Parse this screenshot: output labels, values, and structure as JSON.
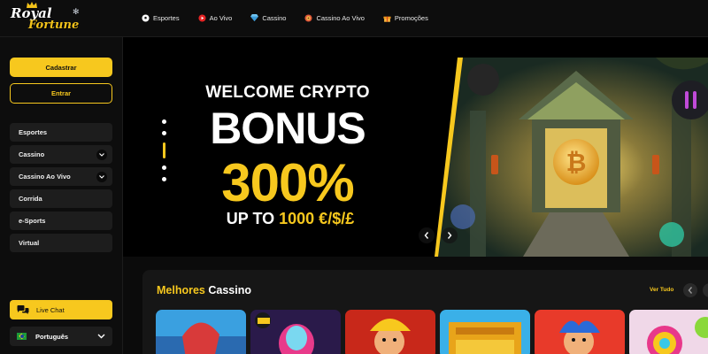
{
  "brand": {
    "line1": "Royal",
    "line2": "Fortune"
  },
  "nav": [
    {
      "label": "Esportes",
      "icon": "soccer-ball-icon"
    },
    {
      "label": "Ao Vivo",
      "icon": "live-play-icon"
    },
    {
      "label": "Cassino",
      "icon": "diamond-icon"
    },
    {
      "label": "Cassino Ao Vivo",
      "icon": "roulette-icon"
    },
    {
      "label": "Promoções",
      "icon": "gift-icon"
    }
  ],
  "sidebar": {
    "signup_label": "Cadastrar",
    "login_label": "Entrar",
    "items": [
      {
        "label": "Esportes",
        "has_dropdown": false
      },
      {
        "label": "Cassino",
        "has_dropdown": true
      },
      {
        "label": "Cassino Ao Vivo",
        "has_dropdown": true
      },
      {
        "label": "Corrida",
        "has_dropdown": false
      },
      {
        "label": "e-Sports",
        "has_dropdown": false
      },
      {
        "label": "Virtual",
        "has_dropdown": false
      }
    ],
    "chat_label": "Live Chat",
    "language_label": "Português"
  },
  "banner": {
    "line1": "WELCOME CRYPTO",
    "line2": "BONUS",
    "line3": "300%",
    "line4_prefix": "UP TO ",
    "line4_highlight": "1000 €/$/£",
    "slide_count": 5,
    "active_slide": 3
  },
  "section": {
    "title_highlight": "Melhores",
    "title_rest": " Cassino",
    "view_all_label": "Ver Tudo",
    "game_tiles": 6
  },
  "colors": {
    "accent": "#f7c81e",
    "background": "#0b0b0b",
    "panel": "#161616",
    "sidebar_item": "#1d1d1d"
  }
}
